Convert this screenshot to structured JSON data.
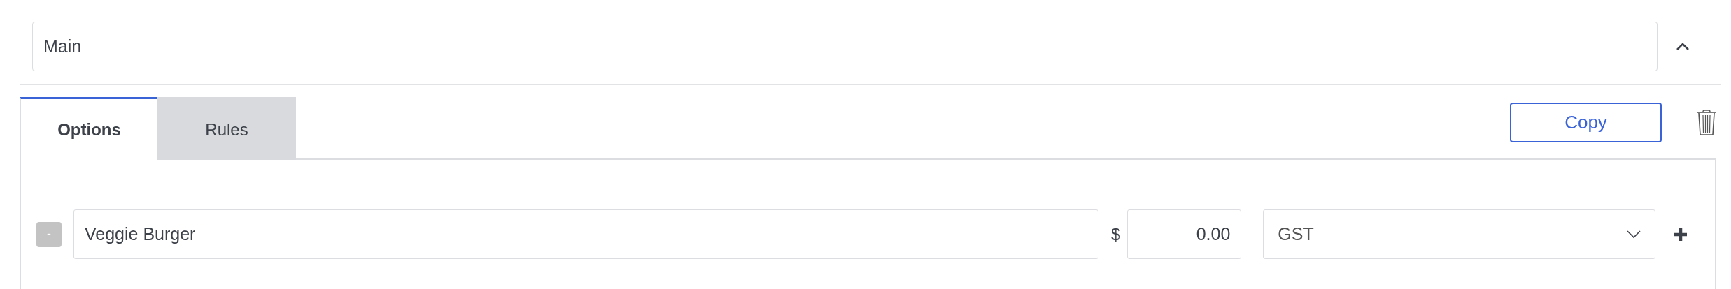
{
  "section": {
    "name": "Main",
    "expanded": true
  },
  "tabs": [
    {
      "label": "Options",
      "selected": true
    },
    {
      "label": "Rules",
      "selected": false
    }
  ],
  "copy_button": "Copy",
  "options": [
    {
      "name": "Veggie Burger",
      "currency": "$",
      "price": "0.00",
      "tax": "GST",
      "remove_label": "-",
      "disabled": true
    }
  ]
}
